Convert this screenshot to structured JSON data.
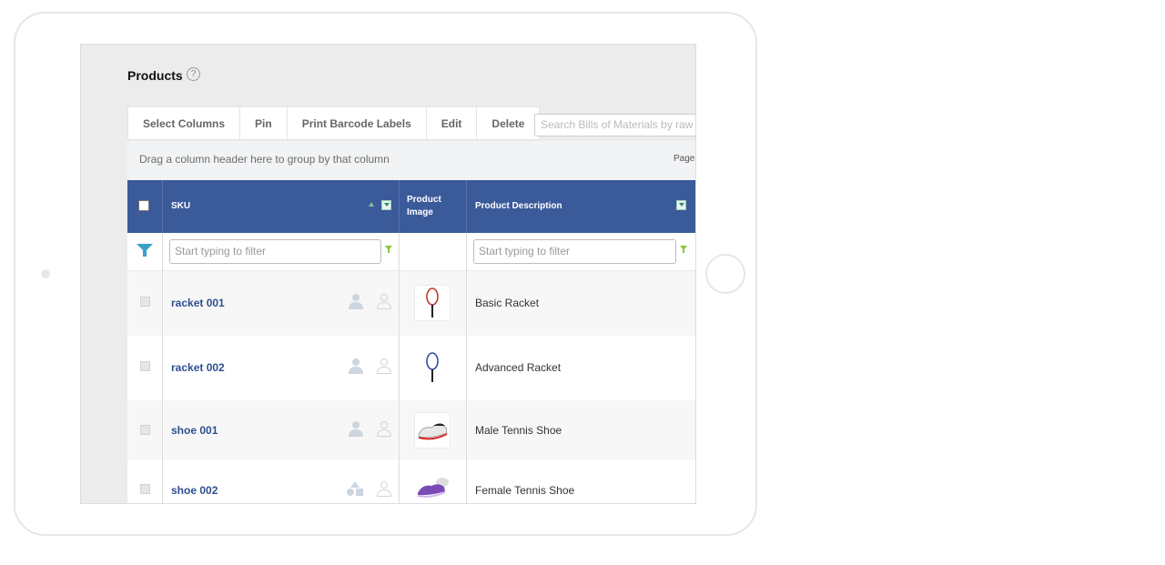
{
  "page": {
    "title": "Products",
    "help_icon": "question-circle-icon"
  },
  "toolbar": {
    "select_columns": "Select Columns",
    "pin": "Pin",
    "print_barcode": "Print Barcode Labels",
    "edit": "Edit",
    "delete": "Delete",
    "search_placeholder": "Search Bills of Materials by raw"
  },
  "groupbar": {
    "hint": "Drag a column header here to group by that column",
    "page_label": "Page"
  },
  "columns": {
    "sku": "SKU",
    "product_image_1": "Product",
    "product_image_2": "Image",
    "product_description": "Product Description"
  },
  "filters": {
    "sku_placeholder": "Start typing to filter",
    "description_placeholder": "Start typing to filter"
  },
  "rows": [
    {
      "sku": "racket 001",
      "description": "Basic Racket",
      "image": "red-tennis-racket",
      "icon_a": "user-filled-icon",
      "icon_b": "user-outline-icon"
    },
    {
      "sku": "racket 002",
      "description": "Advanced Racket",
      "image": "blue-tennis-racket",
      "icon_a": "user-filled-icon",
      "icon_b": "user-outline-icon"
    },
    {
      "sku": "shoe 001",
      "description": "Male Tennis Shoe",
      "image": "red-white-tennis-shoe",
      "icon_a": "user-filled-icon",
      "icon_b": "user-outline-icon"
    },
    {
      "sku": "shoe 002",
      "description": "Female Tennis Shoe",
      "image": "purple-tennis-shoe",
      "icon_a": "shapes-icon",
      "icon_b": "user-outline-icon"
    }
  ],
  "colors": {
    "header": "#3a5a9a",
    "sku_link": "#2f4f8f",
    "filter_accent": "#8cc63f"
  }
}
